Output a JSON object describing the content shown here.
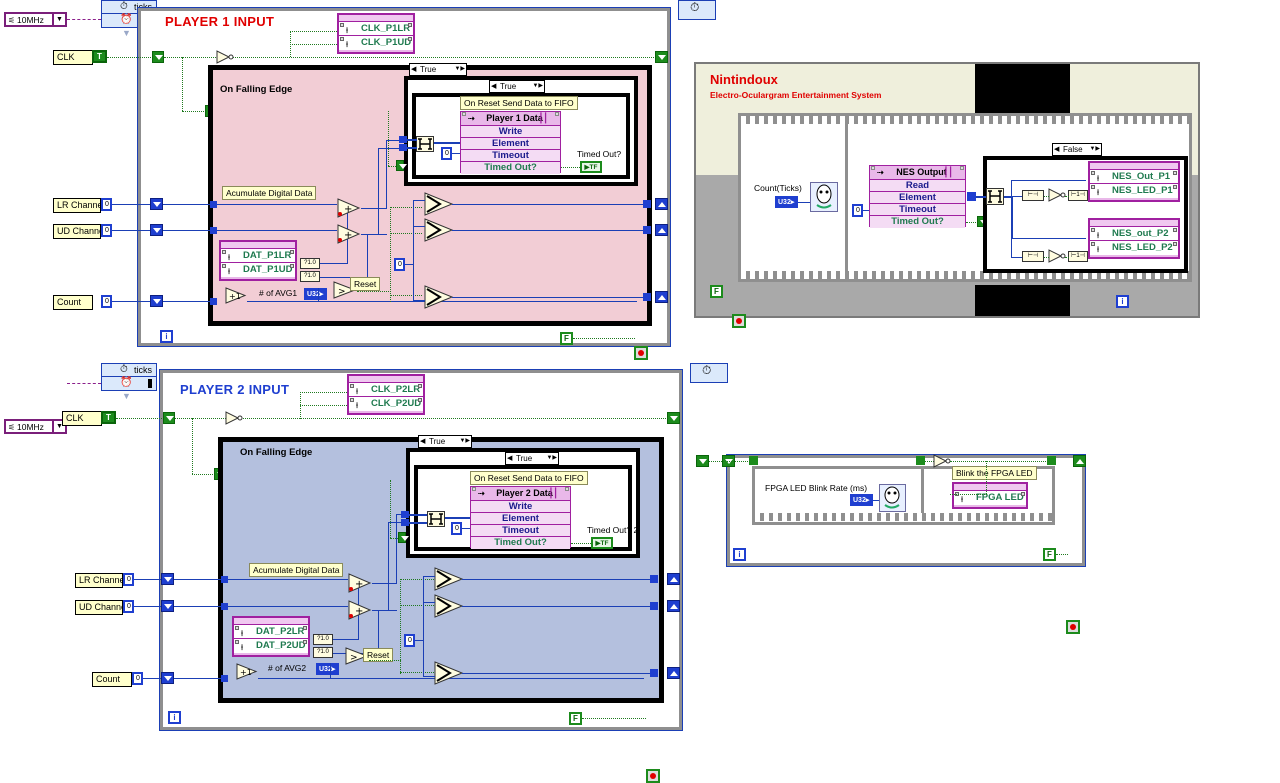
{
  "app": {
    "name": "LabVIEW FPGA Block Diagram",
    "colors": {
      "player1_fill": "#f2cdd5",
      "player2_fill": "#b4c0de",
      "accent_red": "#e00000",
      "accent_blue": "#1f3fd0",
      "fpga_io": "#a020a0",
      "wire_blue": "#1b3fb5",
      "wire_green": "#1f7a1f"
    }
  },
  "player1": {
    "title": "PLAYER 1 INPUT",
    "clock_enum": "10MHz",
    "sctl_ticks_label": "ticks",
    "clk_control": "CLK",
    "clk_bool_value": "T",
    "sctl_caption": "On Falling Edge",
    "clk_io": {
      "lines": [
        "CLK_P1LR",
        "CLK_P1UD"
      ]
    },
    "dat_io": {
      "lines": [
        "DAT_P1LR",
        "DAT_P1UD"
      ]
    },
    "case_outer": "True",
    "case_inner": "True",
    "fifo_comment": "On Reset Send Data to FIFO",
    "fifo": {
      "title": "Player 1 Data",
      "method": "Write",
      "rows": [
        "Element",
        "Timeout",
        "Timed Out?"
      ],
      "timeout_value": "0"
    },
    "timed_out_label": "Timed Out?",
    "timed_out_value": "TF",
    "accumulate_comment": "Acumulate Digital Data",
    "avg_label": "# of AVG1",
    "avg_type": "U32",
    "reset_label": "Reset",
    "controls": [
      {
        "label": "LR Channel",
        "value": "0"
      },
      {
        "label": "UD Channel",
        "value": "0"
      },
      {
        "label": "Count",
        "value": "0"
      }
    ],
    "const_zero": "0",
    "loop_index": "i",
    "loop_stop_const": "F"
  },
  "player2": {
    "title": "PLAYER 2 INPUT",
    "clock_enum": "10MHz",
    "sctl_ticks_label": "ticks",
    "clk_control": "CLK",
    "clk_bool_value": "T",
    "sctl_caption": "On Falling Edge",
    "clk_io": {
      "lines": [
        "CLK_P2LR",
        "CLK_P2UD"
      ]
    },
    "dat_io": {
      "lines": [
        "DAT_P2LR",
        "DAT_P2UD"
      ]
    },
    "case_outer": "True",
    "case_inner": "True",
    "fifo_comment": "On Reset Send Data to FIFO",
    "fifo": {
      "title": "Player 2 Data",
      "method": "Write",
      "rows": [
        "Element",
        "Timeout",
        "Timed Out?"
      ],
      "timeout_value": "0"
    },
    "timed_out_label": "Timed Out? 2",
    "timed_out_value": "TF",
    "accumulate_comment": "Acumulate Digital Data",
    "avg_label": "# of AVG2",
    "avg_type": "U32",
    "reset_label": "Reset",
    "controls": [
      {
        "label": "LR Channel",
        "value": "0"
      },
      {
        "label": "UD Channel",
        "value": "0"
      },
      {
        "label": "Count",
        "value": "0"
      }
    ],
    "const_zero": "0",
    "loop_index": "i",
    "loop_stop_const": "F"
  },
  "nintindoux": {
    "title": "Nintindoux",
    "subtitle": "Electro-Oculargram Entertainment System",
    "count_label": "Count(Ticks)",
    "count_type": "U32",
    "fifo": {
      "title": "NES Output",
      "method": "Read",
      "rows": [
        "Element",
        "Timeout",
        "Timed Out?"
      ],
      "timeout_value": "0"
    },
    "case_sel": "False",
    "io_p1": [
      "NES_Out_P1",
      "NES_LED_P1"
    ],
    "io_p2": [
      "NES_out_P2",
      "NES_LED_P2"
    ],
    "loop_stop_const": "F",
    "loop_index": "i"
  },
  "fpga_led": {
    "blink_label": "FPGA LED Blink Rate (ms)",
    "blink_type": "U32",
    "comment": "Blink the FPGA LED",
    "io_line": "FPGA LED",
    "loop_index": "i",
    "loop_stop_const": "F"
  }
}
